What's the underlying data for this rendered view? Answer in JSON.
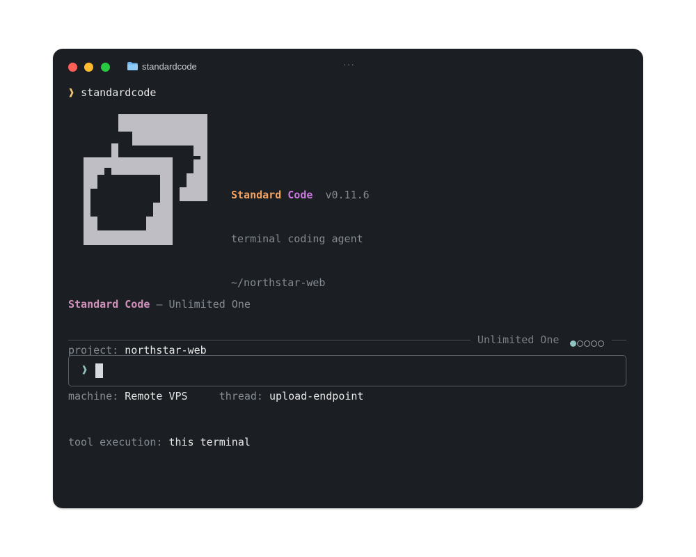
{
  "window": {
    "title": "standardcode",
    "more_icon": "ellipsis-icon"
  },
  "prompt": {
    "chevron": "❱",
    "command": "standardcode"
  },
  "banner": {
    "name_part1": "Standard",
    "name_part2": "Code",
    "version": "v0.11.6",
    "tagline": "terminal coding agent",
    "path": "~/northstar-web"
  },
  "status": {
    "product_part1": "Standard",
    "product_part2": "Code",
    "dash": "–",
    "plan": "Unlimited One",
    "project_label": "project:",
    "project_value": "northstar-web",
    "machine_label": "machine:",
    "machine_value": "Remote VPS",
    "thread_label": "thread:",
    "thread_value": "upload-endpoint",
    "tool_label": "tool execution:",
    "tool_value": "this terminal"
  },
  "separator": {
    "label": "Unlimited One",
    "level_filled": 1,
    "level_total": 5
  },
  "input": {
    "chevron": "❱",
    "value": ""
  },
  "colors": {
    "window_bg": "#1b1f23",
    "accent_orange": "#f4a261",
    "accent_violet": "#c678dd",
    "accent_teal": "#8fc3c0",
    "logo": "#bfbec4"
  }
}
